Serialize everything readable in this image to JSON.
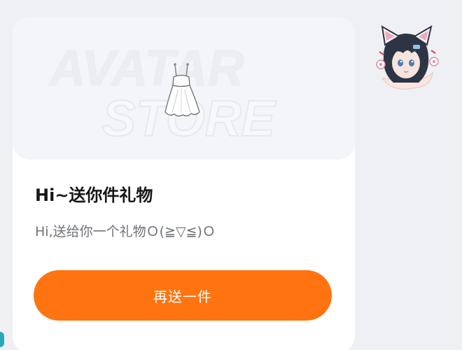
{
  "banner": {
    "watermark_line1": "AVATAR",
    "watermark_line2": "STORE",
    "gift_icon": "dress-icon"
  },
  "gift_card": {
    "title": "Hi~送你件礼物",
    "message": "Hi,送给你一个礼物Ｏ(≧▽≦)Ｏ",
    "send_again_label": "再送一件"
  },
  "avatar": {
    "icon": "anime-girl-cat-ears-avatar"
  },
  "colors": {
    "accent": "#ff7411",
    "card_bg": "#ffffff",
    "page_bg": "#eef0f3",
    "banner_bg": "#f3f5f8"
  }
}
